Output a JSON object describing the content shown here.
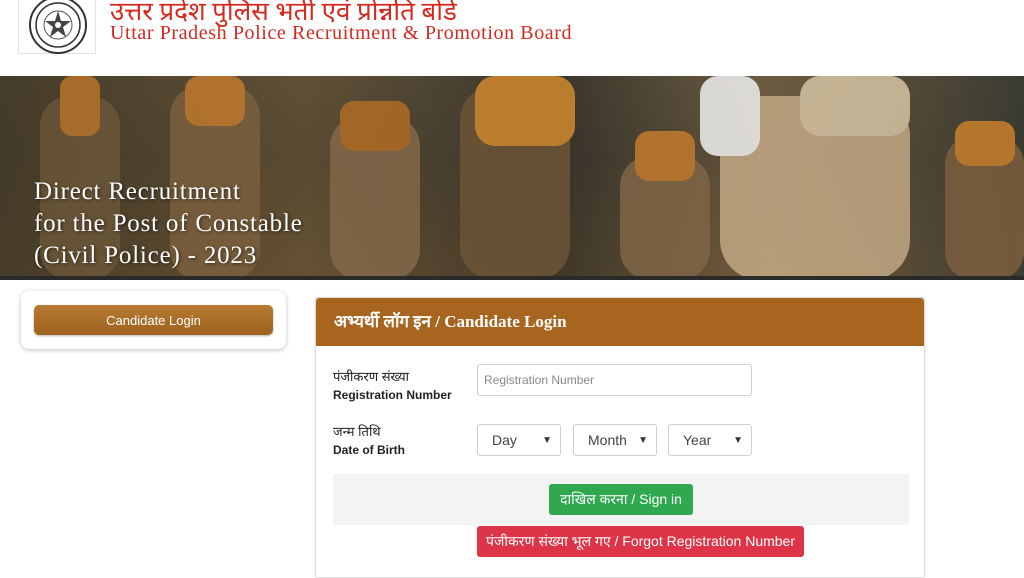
{
  "header": {
    "org_name_hindi": "उत्तर प्रदेश पुलिस भर्ती एवं प्रोन्नति बोर्ड",
    "org_name_english": "Uttar Pradesh Police Recruitment & Promotion Board"
  },
  "banner": {
    "line1": "Direct Recruitment",
    "line2": "for the Post of Constable",
    "line3": "(Civil Police) - 2023"
  },
  "sidebar": {
    "candidate_login_label": "Candidate Login"
  },
  "login": {
    "title": "अभ्यर्थी लॉग इन / Candidate Login",
    "registration_label_hindi": "पंजीकरण संख्या",
    "registration_label_english": "Registration Number",
    "registration_placeholder": "Registration Number",
    "dob_label_hindi": "जन्म तिथि",
    "dob_label_english": "Date of Birth",
    "day_label": "Day",
    "month_label": "Month",
    "year_label": "Year",
    "sign_in_label": "दाखिल करना / Sign in",
    "forgot_label": "पंजीकरण संख्या भूल गए / Forgot Registration Number"
  },
  "colors": {
    "brand_red": "#d32a1f",
    "header_brown": "#a8651f",
    "sign_in_green": "#2fa84f",
    "forgot_red": "#de3447"
  }
}
